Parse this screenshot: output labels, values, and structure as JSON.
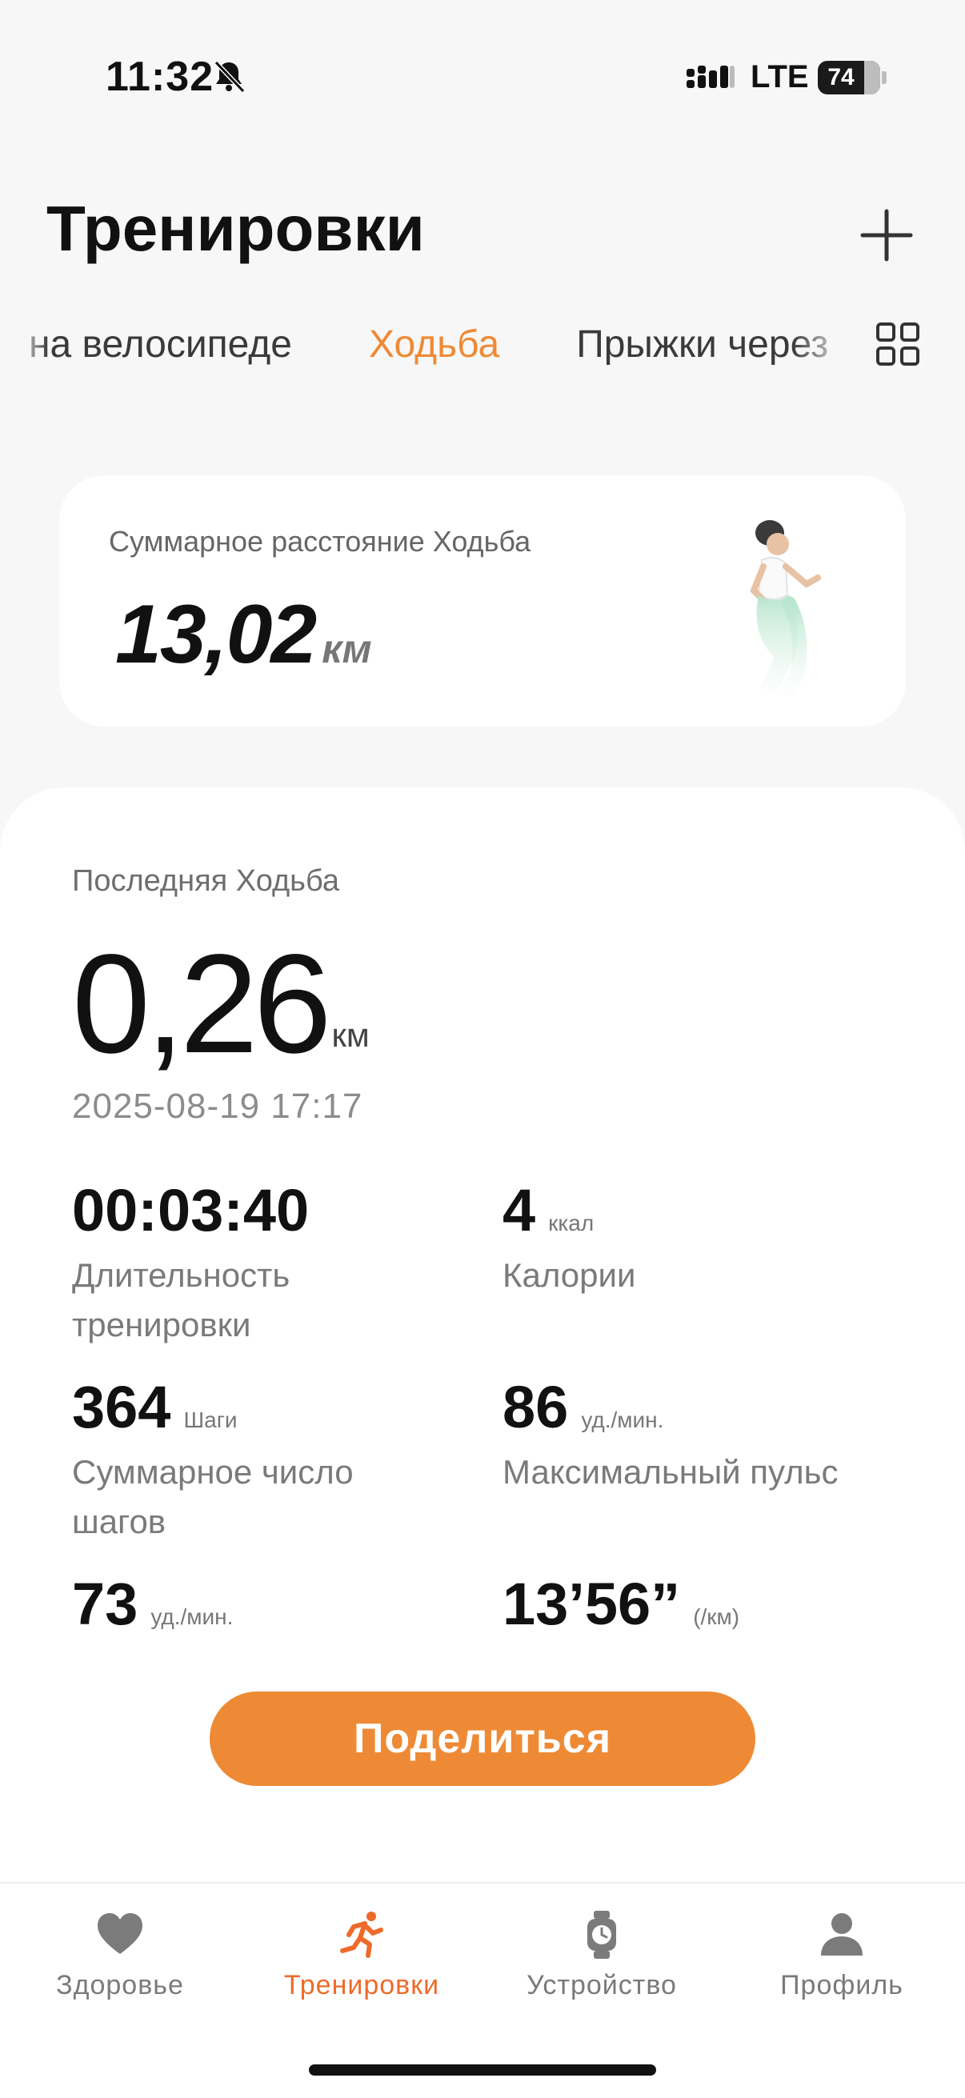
{
  "status_bar": {
    "time": "11:32",
    "network": "LTE",
    "battery": "74"
  },
  "header": {
    "title": "Тренировки",
    "add_icon": "plus-icon"
  },
  "tabs": {
    "items": [
      {
        "label": "на велосипеде",
        "active": false
      },
      {
        "label": "Ходьба",
        "active": true
      },
      {
        "label": "Прыжки через",
        "active": false
      }
    ],
    "grid_icon": "grid-icon"
  },
  "summary": {
    "label": "Суммарное расстояние Ходьба",
    "value": "13,02",
    "unit": "км"
  },
  "last_workout": {
    "label": "Последняя Ходьба",
    "distance": "0,26",
    "distance_unit": "км",
    "timestamp": "2025-08-19 17:17",
    "metrics": {
      "duration": {
        "value": "00:03:40",
        "unit": "",
        "label": "Длительность тренировки"
      },
      "calories": {
        "value": "4",
        "unit": "ккал",
        "label": "Калории"
      },
      "steps": {
        "value": "364",
        "unit": "Шаги",
        "label": "Суммарное число шагов"
      },
      "max_pulse": {
        "value": "86",
        "unit": "уд./мин.",
        "label": "Максимальный пульс"
      },
      "cadence": {
        "value": "73",
        "unit": "уд./мин."
      },
      "pace": {
        "value": "13’56”",
        "unit": "(/км)"
      }
    },
    "share_label": "Поделиться"
  },
  "nav": {
    "items": [
      {
        "label": "Здоровье",
        "icon": "heart-icon",
        "active": false
      },
      {
        "label": "Тренировки",
        "icon": "running-icon",
        "active": true
      },
      {
        "label": "Устройство",
        "icon": "watch-icon",
        "active": false
      },
      {
        "label": "Профиль",
        "icon": "person-icon",
        "active": false
      }
    ]
  },
  "colors": {
    "accent": "#ee8a35",
    "nav_active": "#ee6a2a",
    "background": "#f7f7f7"
  }
}
